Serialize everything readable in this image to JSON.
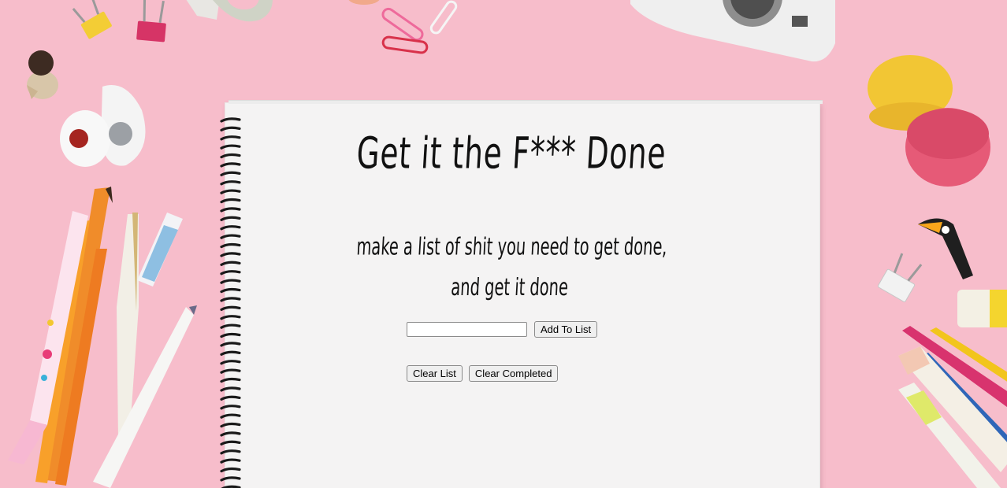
{
  "page": {
    "title": "Get it the F*** Done",
    "tagline": [
      "make a list of shit you need to get done,",
      "and get it done"
    ]
  },
  "form": {
    "input_value": "",
    "add_label": "Add To List",
    "clear_list_label": "Clear List",
    "clear_completed_label": "Clear Completed"
  },
  "colors": {
    "background": "#f7bdcb",
    "paper": "#f4f3f3",
    "ink": "#111111"
  },
  "icons": [
    "binder-clip-icon",
    "paper-clip-icon",
    "camera-icon",
    "macaron-icon",
    "pencil-icon",
    "marker-icon",
    "pen-icon",
    "eraser-icon",
    "toucan-sticker-icon",
    "crayon-icon"
  ]
}
